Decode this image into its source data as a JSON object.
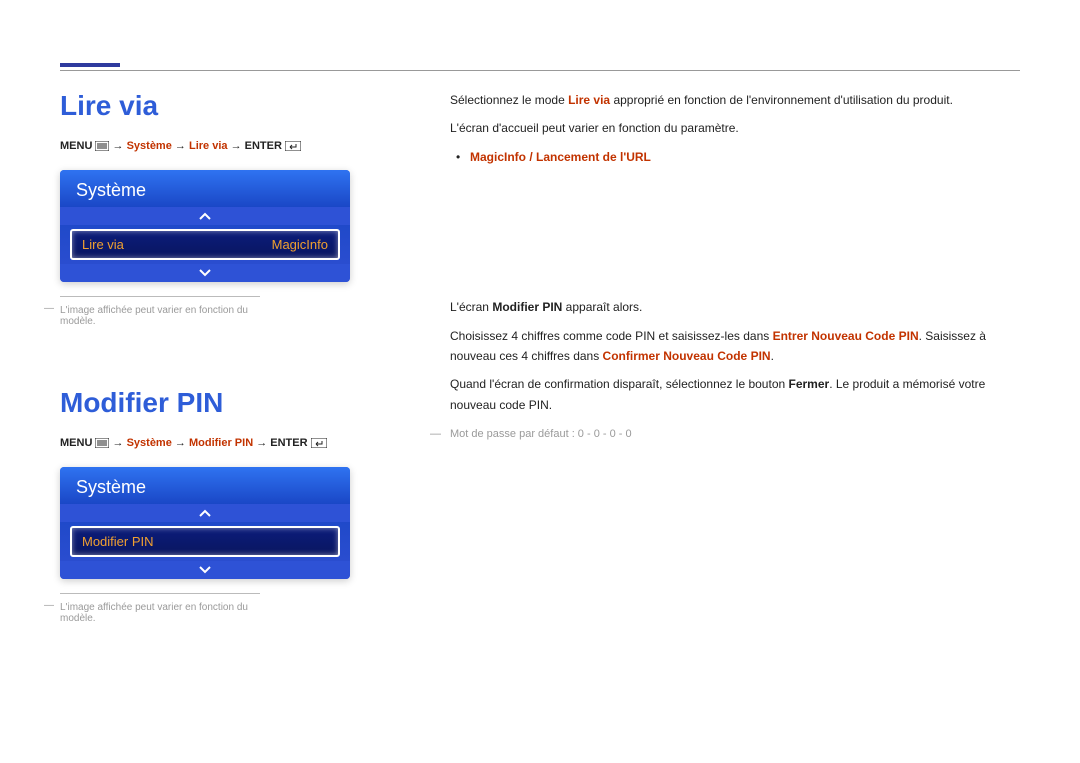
{
  "section1": {
    "title": "Lire via",
    "breadcrumb": {
      "prefix": "MENU ",
      "tail": " → ENTER ",
      "path1": "Système",
      "path2": "Lire via"
    },
    "panel": {
      "header": "Système",
      "item_label": "Lire via",
      "item_value": "MagicInfo",
      "note": "L'image affichée peut varier en fonction du modèle."
    },
    "right": {
      "p1a": "Sélectionnez le mode ",
      "p1b": "Lire via",
      "p1c": " approprié en fonction de l'environnement d'utilisation du produit.",
      "p2": "L'écran d'accueil peut varier en fonction du paramètre.",
      "bullet": "MagicInfo / Lancement de l'URL"
    }
  },
  "section2": {
    "title": "Modifier PIN",
    "breadcrumb": {
      "prefix": "MENU ",
      "tail": " → ENTER ",
      "path1": "Système",
      "path2": "Modifier PIN"
    },
    "panel": {
      "header": "Système",
      "item_label": "Modifier PIN",
      "note": "L'image affichée peut varier en fonction du modèle."
    },
    "right": {
      "p1a": "L'écran ",
      "p1b": "Modifier PIN",
      "p1c": " apparaît alors.",
      "p2a": "Choisissez 4 chiffres comme code PIN et saisissez-les dans ",
      "p2b": "Entrer Nouveau Code PIN",
      "p2c": ". Saisissez à nouveau ces 4 chiffres dans ",
      "p2d": "Confirmer Nouveau Code PIN",
      "p2e": ".",
      "p3a": "Quand l'écran de confirmation disparaît, sélectionnez le bouton ",
      "p3b": "Fermer",
      "p3c": ". Le produit a mémorisé votre nouveau code PIN.",
      "note": "Mot de passe par défaut : 0 - 0 - 0 - 0"
    }
  }
}
